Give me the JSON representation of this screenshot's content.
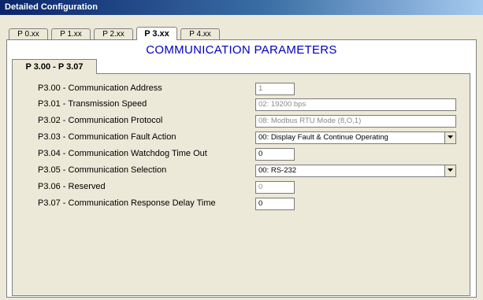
{
  "window": {
    "title": "Detailed Configuration"
  },
  "tabs": [
    "P 0.xx",
    "P 1.xx",
    "P 2.xx",
    "P 3.xx",
    "P 4.xx"
  ],
  "section_title": "COMMUNICATION PARAMETERS",
  "subtab": "P 3.00 - P 3.07",
  "params": [
    {
      "label": "P3.00 - Communication Address",
      "value": "1",
      "state": "disabled",
      "control": "text"
    },
    {
      "label": "P3.01 - Transmission Speed",
      "value": "02: 19200 bps",
      "state": "disabled",
      "control": "text"
    },
    {
      "label": "P3.02 - Communication Protocol",
      "value": "08: Modbus RTU Mode (8,O,1)",
      "state": "disabled",
      "control": "text"
    },
    {
      "label": "P3.03 - Communication Fault Action",
      "value": "00: Display Fault & Continue Operating",
      "state": "enabled",
      "control": "select"
    },
    {
      "label": "P3.04 - Communication Watchdog Time Out",
      "value": "0",
      "state": "enabled",
      "control": "text"
    },
    {
      "label": "P3.05 - Communication Selection",
      "value": "00: RS-232",
      "state": "enabled",
      "control": "select"
    },
    {
      "label": "P3.06 - Reserved",
      "value": "0",
      "state": "disabled",
      "control": "text"
    },
    {
      "label": "P3.07 - Communication Response Delay Time",
      "value": "0",
      "state": "enabled",
      "control": "text"
    }
  ],
  "colors": {
    "title_bar": "#0a246a",
    "section_title": "#0000c0",
    "window_bg": "#ece9d8",
    "disabled_text": "#8a8a8a"
  }
}
